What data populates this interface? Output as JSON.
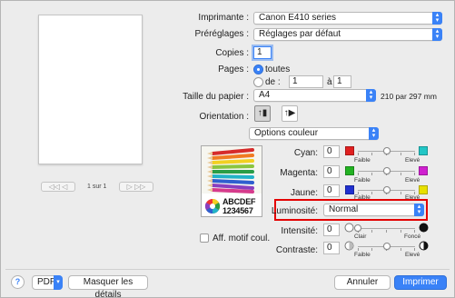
{
  "printer": {
    "label": "Imprimante :",
    "value": "Canon E410 series"
  },
  "presets": {
    "label": "Préréglages :",
    "value": "Réglages par défaut"
  },
  "copies": {
    "label": "Copies :",
    "value": "1"
  },
  "pages": {
    "label": "Pages :",
    "all_label": "toutes",
    "from_label": "de :",
    "from_value": "1",
    "to_label": "à :",
    "to_value": "1",
    "selected": "toutes"
  },
  "paper_size": {
    "label": "Taille du papier :",
    "value": "A4",
    "dims": "210 par 297 mm"
  },
  "orientation": {
    "label": "Orientation :",
    "portrait_icon": "portrait-orientation-icon",
    "landscape_icon": "landscape-orientation-icon",
    "selected": "portrait"
  },
  "section_popup": {
    "value": "Options couleur"
  },
  "preview": {
    "page_indicator": "1 sur 1",
    "sample_text_1": "ABCDEF",
    "sample_text_2": "1234567"
  },
  "color_adjust": {
    "cyan": {
      "label": "Cyan:",
      "value": "0",
      "color_low": "#e02020",
      "color_high": "#22c6c6",
      "left": "Faible",
      "right": "Elevé",
      "level": 0.5
    },
    "magenta": {
      "label": "Magenta:",
      "value": "0",
      "color_low": "#22b222",
      "color_high": "#d020d0",
      "left": "Faible",
      "right": "Elevé",
      "level": 0.5
    },
    "yellow": {
      "label": "Jaune:",
      "value": "0",
      "color_low": "#2030d0",
      "color_high": "#e8e000",
      "left": "Faible",
      "right": "Elevé",
      "level": 0.5
    }
  },
  "brightness": {
    "label": "Luminosité:",
    "value": "Normal"
  },
  "intensity": {
    "label": "Intensité:",
    "value": "0",
    "left": "Clair",
    "right": "Foncé",
    "level": 0.0
  },
  "contrast": {
    "label": "Contraste:",
    "value": "0",
    "left": "Faible",
    "right": "Elevé",
    "level": 0.5
  },
  "show_pattern": {
    "label": "Aff. motif coul.",
    "checked": false
  },
  "footer": {
    "help": "?",
    "pdf": "PDF",
    "hide_details": "Masquer les détails",
    "cancel": "Annuler",
    "print": "Imprimer"
  },
  "accent": "#3a82f7",
  "highlight": "#e30000"
}
